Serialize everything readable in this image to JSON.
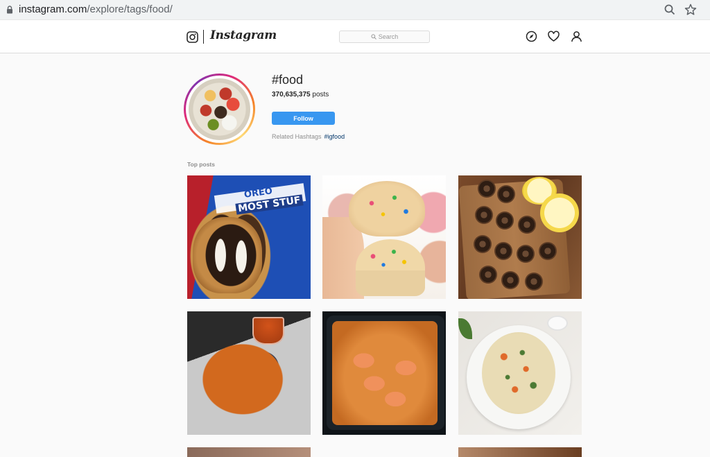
{
  "browser": {
    "url_host": "instagram.com",
    "url_path": "/explore/tags/food/"
  },
  "header": {
    "logo_text": "Instagram",
    "search_placeholder": "Search"
  },
  "hashtag": {
    "title": "#food",
    "post_count": "370,635,375",
    "post_label": "posts",
    "follow_label": "Follow",
    "related_label": "Related Hashtags",
    "related_tags": [
      "#igfood"
    ]
  },
  "top_posts": {
    "label": "Top posts"
  },
  "colors": {
    "accent": "#3897f0",
    "link": "#003569",
    "muted": "#8e8e8e",
    "border": "#dbdbdb"
  },
  "icons": [
    "lock-icon",
    "zoom-icon",
    "star-icon",
    "instagram-glyph-icon",
    "search-icon",
    "explore-icon",
    "heart-icon",
    "profile-icon"
  ]
}
